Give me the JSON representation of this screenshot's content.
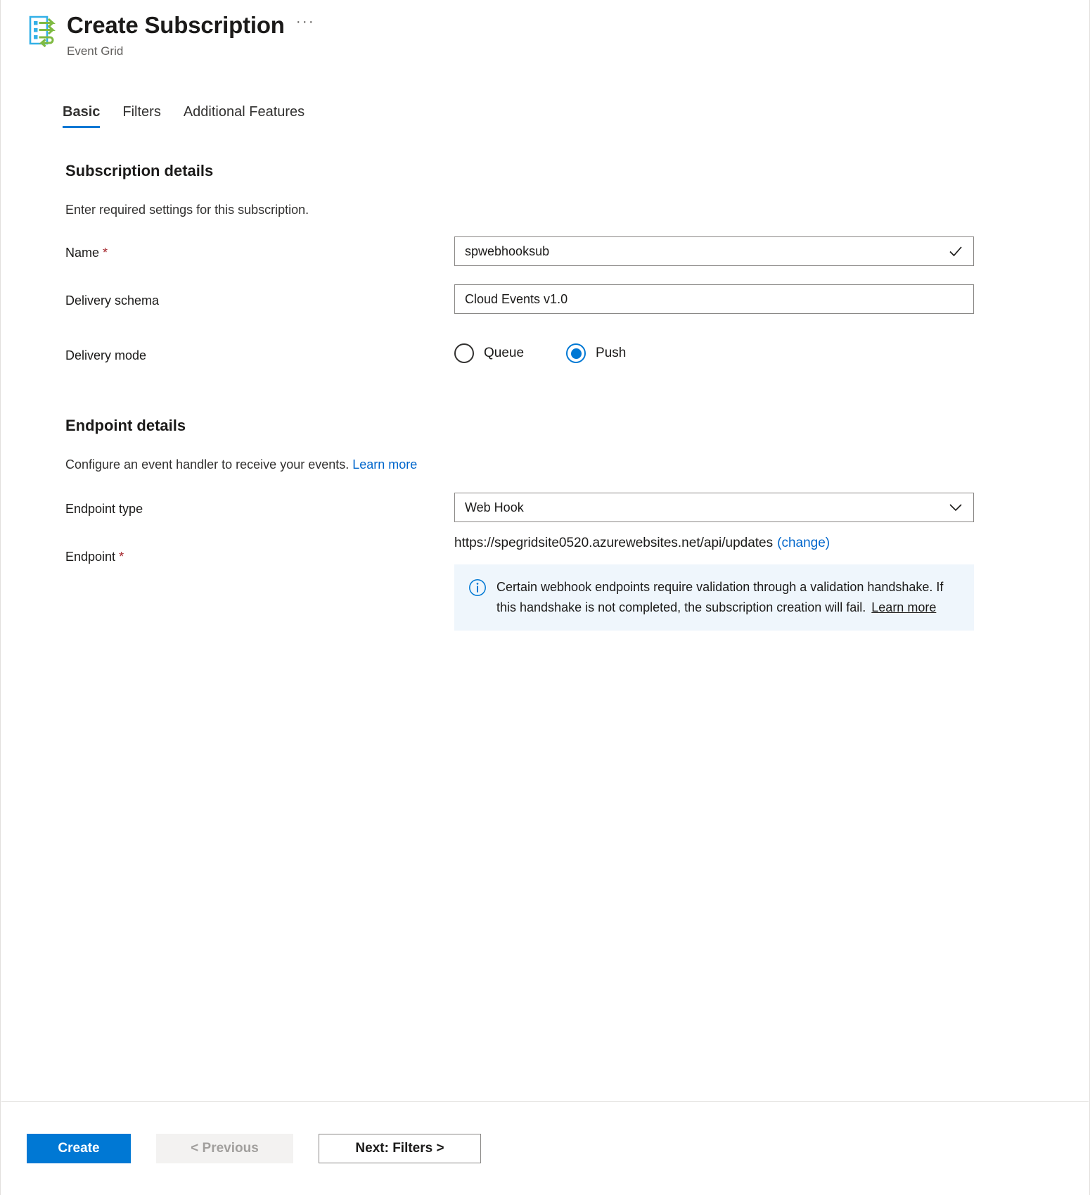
{
  "header": {
    "title": "Create Subscription",
    "subtitle": "Event Grid",
    "more_label": "···",
    "icon": "event-grid-icon"
  },
  "tabs": [
    {
      "label": "Basic",
      "active": true
    },
    {
      "label": "Filters",
      "active": false
    },
    {
      "label": "Additional Features",
      "active": false
    }
  ],
  "subscription_details": {
    "heading": "Subscription details",
    "description": "Enter required settings for this subscription.",
    "name": {
      "label": "Name",
      "required_mark": "*",
      "value": "spwebhooksub",
      "placeholder": "",
      "validation_icon": "checkmark-icon"
    },
    "delivery_schema": {
      "label": "Delivery schema",
      "value": "Cloud Events v1.0"
    },
    "delivery_mode": {
      "label": "Delivery mode",
      "options": [
        {
          "label": "Queue",
          "selected": false
        },
        {
          "label": "Push",
          "selected": true
        }
      ]
    }
  },
  "endpoint_details": {
    "heading": "Endpoint details",
    "description": "Configure an event handler to receive your events.",
    "learn_more": "Learn more",
    "endpoint_type": {
      "label": "Endpoint type",
      "value": "Web Hook",
      "chevron_icon": "chevron-down-icon"
    },
    "endpoint": {
      "label": "Endpoint",
      "required_mark": "*",
      "url": "https://spegridsite0520.azurewebsites.net/api/updates",
      "change_link": "(change)"
    },
    "info": {
      "icon": "info-icon",
      "text": "Certain webhook endpoints require validation through a validation handshake. If this handshake is not completed, the subscription creation will fail.",
      "learn_more": "Learn more"
    }
  },
  "footer": {
    "create_label": "Create",
    "previous_label": "< Previous",
    "next_label": "Next: Filters >"
  },
  "colors": {
    "accent": "#0078d4",
    "link": "#0066cc",
    "required": "#a4262c",
    "info_bg": "#eff6fc",
    "icon_blue": "#32b0e7",
    "icon_green": "#7fba42"
  }
}
